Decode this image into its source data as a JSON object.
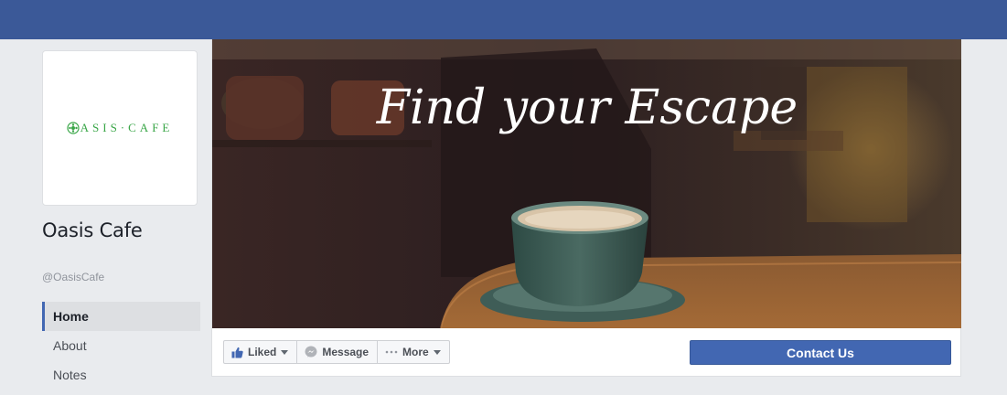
{
  "page": {
    "logo_text": "ASIS·CAFE",
    "name": "Oasis Cafe",
    "handle": "@OasisCafe"
  },
  "nav": [
    {
      "label": "Home",
      "active": true
    },
    {
      "label": "About",
      "active": false
    },
    {
      "label": "Notes",
      "active": false
    }
  ],
  "cover": {
    "tagline": "Find your Escape"
  },
  "actions": {
    "liked_label": "Liked",
    "message_label": "Message",
    "more_label": "More",
    "contact_label": "Contact Us"
  },
  "colors": {
    "brand_blue": "#3b5998",
    "button_blue": "#4267b2",
    "logo_green": "#3aa648",
    "page_bg": "#e9ebee"
  },
  "icons": [
    "thumbs-up-icon",
    "messenger-icon",
    "more-dots-icon",
    "chevron-down-icon",
    "logo-flower-icon"
  ]
}
